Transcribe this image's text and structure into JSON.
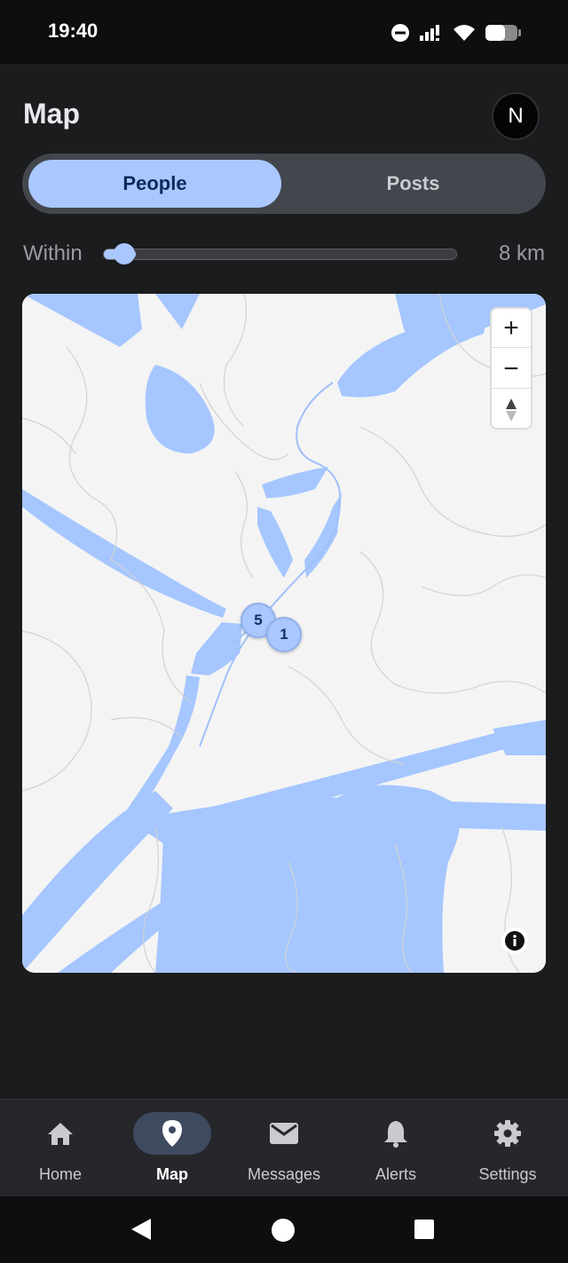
{
  "status_bar": {
    "time": "19:40"
  },
  "header": {
    "title": "Map",
    "avatar_initial": "N"
  },
  "segments": {
    "people": "People",
    "posts": "Posts",
    "selected": "People"
  },
  "distance_filter": {
    "label": "Within",
    "value_text": "8 km",
    "fraction": 0.06
  },
  "map": {
    "clusters": [
      {
        "label": "5"
      },
      {
        "label": "1"
      }
    ],
    "controls": {
      "zoom_in": "+",
      "zoom_out": "−"
    }
  },
  "bottom_nav": {
    "items": [
      {
        "label": "Home",
        "icon": "home-icon"
      },
      {
        "label": "Map",
        "icon": "map-pin-icon",
        "active": true
      },
      {
        "label": "Messages",
        "icon": "mail-icon"
      },
      {
        "label": "Alerts",
        "icon": "bell-icon"
      },
      {
        "label": "Settings",
        "icon": "gear-icon"
      }
    ]
  },
  "colors": {
    "accent": "#aac7ff",
    "background": "#1b1c1e",
    "water": "#a5c6ff",
    "land": "#f4f4f4"
  }
}
